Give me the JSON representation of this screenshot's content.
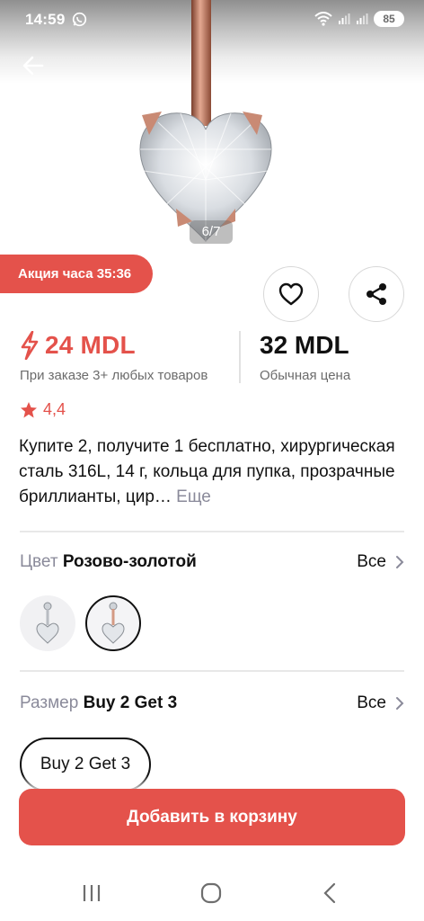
{
  "status_bar": {
    "time": "14:59",
    "battery": "85"
  },
  "gallery": {
    "counter": "6/7"
  },
  "promo": {
    "badge": "Акция часа 35:36"
  },
  "price": {
    "promo_price": "24 MDL",
    "promo_note": "При заказе 3+ любых товаров",
    "regular_price": "32 MDL",
    "regular_note": "Обычная цена"
  },
  "rating": {
    "value": "4,4"
  },
  "product": {
    "title": "Купите 2, получите 1 бесплатно, хирургическая сталь 316L, 14 г, кольца для пупка, прозрачные бриллианты, цир…",
    "more": "Еще"
  },
  "color_option": {
    "label": "Цвет",
    "value": "Розово-золотой",
    "all": "Все"
  },
  "size_option": {
    "label": "Размер",
    "value": "Buy 2 Get 3",
    "all": "Все",
    "chip": "Buy 2 Get 3"
  },
  "cart": {
    "button": "Добавить в корзину"
  },
  "colors": {
    "accent": "#e4524b",
    "muted": "#8a8a9a"
  }
}
